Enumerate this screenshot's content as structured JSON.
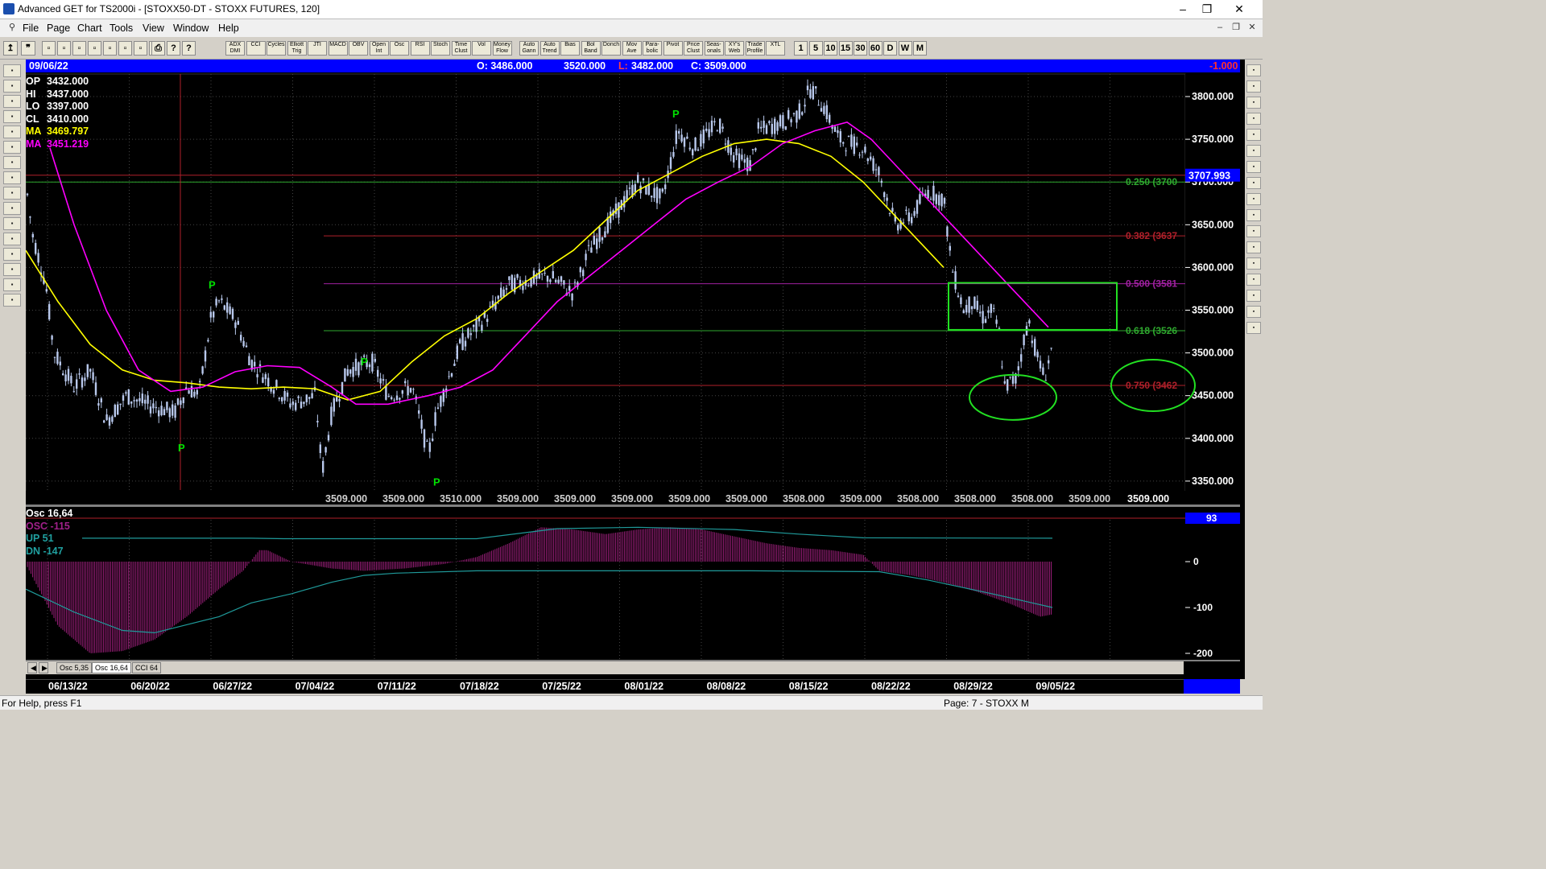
{
  "window": {
    "title": "Advanced GET for TS2000i - [STOXX50-DT - STOXX FUTURES, 120]",
    "minimize": "–",
    "restore": "❐",
    "close": "✕"
  },
  "menu": {
    "items": [
      "File",
      "Page",
      "Chart",
      "Tools",
      "View",
      "Window",
      "Help"
    ],
    "mdi_controls": [
      "–",
      "❐",
      "✕"
    ]
  },
  "toolbar": {
    "study_buttons": [
      "ADX DMI",
      "CCI",
      "Cycles",
      "Elliott Trig",
      "JTI",
      "MACD",
      "OBV",
      "Open Int",
      "Osc",
      "RSI",
      "Stoch",
      "Time Clust",
      "Vol",
      "Money Flow",
      "Auto Gann",
      "Auto Trend",
      "Bias",
      "Bol Band",
      "Donch",
      "Mov Ave",
      "Para-bolic",
      "Pivot",
      "Price Clust",
      "Seas-onals",
      "XY's Web",
      "Trade Profile",
      "XTL"
    ],
    "interval_buttons": [
      "1",
      "5",
      "10",
      "15",
      "30",
      "60",
      "D",
      "W",
      "M"
    ]
  },
  "left_tools": [
    "OPEN",
    "PRINT",
    "RESET",
    "STUDY",
    "Elliott",
    "UP",
    "DOWN",
    "LEFT",
    "RIGHT",
    "ZOOM",
    "ERASE",
    "LINES",
    "GANN",
    "FIB",
    "CROSS",
    "SAVE"
  ],
  "right_tools": [
    "X",
    "/",
    "\\",
    "FIB RET",
    "FIB EXT",
    "FIB TIME",
    "ARC",
    "FAN",
    "ELLPS",
    "PTI",
    "GRID",
    "MOB",
    "A",
    "ZOOM",
    "CLR",
    "PRN",
    "U"
  ],
  "header": {
    "date": "09/06/22",
    "open": "O: 3486.000",
    "high": "3520.000",
    "low_label": "L:",
    "low_value": "3482.000",
    "close": "C: 3509.000",
    "change": "-1.000"
  },
  "info_panel": [
    {
      "label": "OP",
      "value": "3432.000",
      "color": "#ffffff"
    },
    {
      "label": "HI",
      "value": "3437.000",
      "color": "#ffffff"
    },
    {
      "label": "LO",
      "value": "3397.000",
      "color": "#ffffff"
    },
    {
      "label": "CL",
      "value": "3410.000",
      "color": "#ffffff"
    },
    {
      "label": "MA",
      "value": "3469.797",
      "color": "#ffff00"
    },
    {
      "label": "MA",
      "value": "3451.219",
      "color": "#ff00ff"
    }
  ],
  "fib_levels": [
    {
      "label": "0.250 (3700",
      "price": 3700,
      "color": "#2ea82e"
    },
    {
      "label": "0.382 (3637",
      "price": 3637,
      "color": "#b0202a"
    },
    {
      "label": "0.500 (3581",
      "price": 3581,
      "color": "#a020a0"
    },
    {
      "label": "0.618 (3526",
      "price": 3526,
      "color": "#2ea82e"
    },
    {
      "label": "0.750 (3462",
      "price": 3462,
      "color": "#b0202a"
    }
  ],
  "current_price_box": "3707.993",
  "price_axis": [
    "3800.000",
    "3750.000",
    "3700.000",
    "3650.000",
    "3600.000",
    "3550.000",
    "3500.000",
    "3450.000",
    "3400.000",
    "3350.000"
  ],
  "bottom_price_labels": [
    "3509.000",
    "3509.000",
    "3510.000",
    "3509.000",
    "3509.000",
    "3509.000",
    "3509.000",
    "3509.000",
    "3508.000",
    "3509.000",
    "3508.000",
    "3508.000",
    "3508.000",
    "3509.000",
    "3509.000"
  ],
  "pivot_marker": "P",
  "oscillator": {
    "info": [
      {
        "text": "Osc 16,64",
        "color": "#ffffff"
      },
      {
        "text": "OSC -115",
        "color": "#a0208a"
      },
      {
        "text": "UP   51",
        "color": "#20a0a0"
      },
      {
        "text": "DN   -147",
        "color": "#20a0a0"
      }
    ],
    "axis": [
      "0",
      "-100",
      "-200"
    ],
    "top_value": "93"
  },
  "tabs": [
    "Osc 5,35",
    "Osc 16,64",
    "CCI 64"
  ],
  "dates": [
    "06/13/22",
    "06/20/22",
    "06/27/22",
    "07/04/22",
    "07/11/22",
    "07/18/22",
    "07/25/22",
    "08/01/22",
    "08/08/22",
    "08/15/22",
    "08/22/22",
    "08/29/22",
    "09/05/22"
  ],
  "status": {
    "help": "For Help, press F1",
    "page": "Page: 7 - STOXX M"
  },
  "colors": {
    "candle": "#b8c8ec",
    "ma_fast": "#ffff00",
    "ma_slow": "#ff00ff",
    "pivot": "#00e000",
    "annotation": "#22e022",
    "axis_box": "#0000ff"
  }
}
